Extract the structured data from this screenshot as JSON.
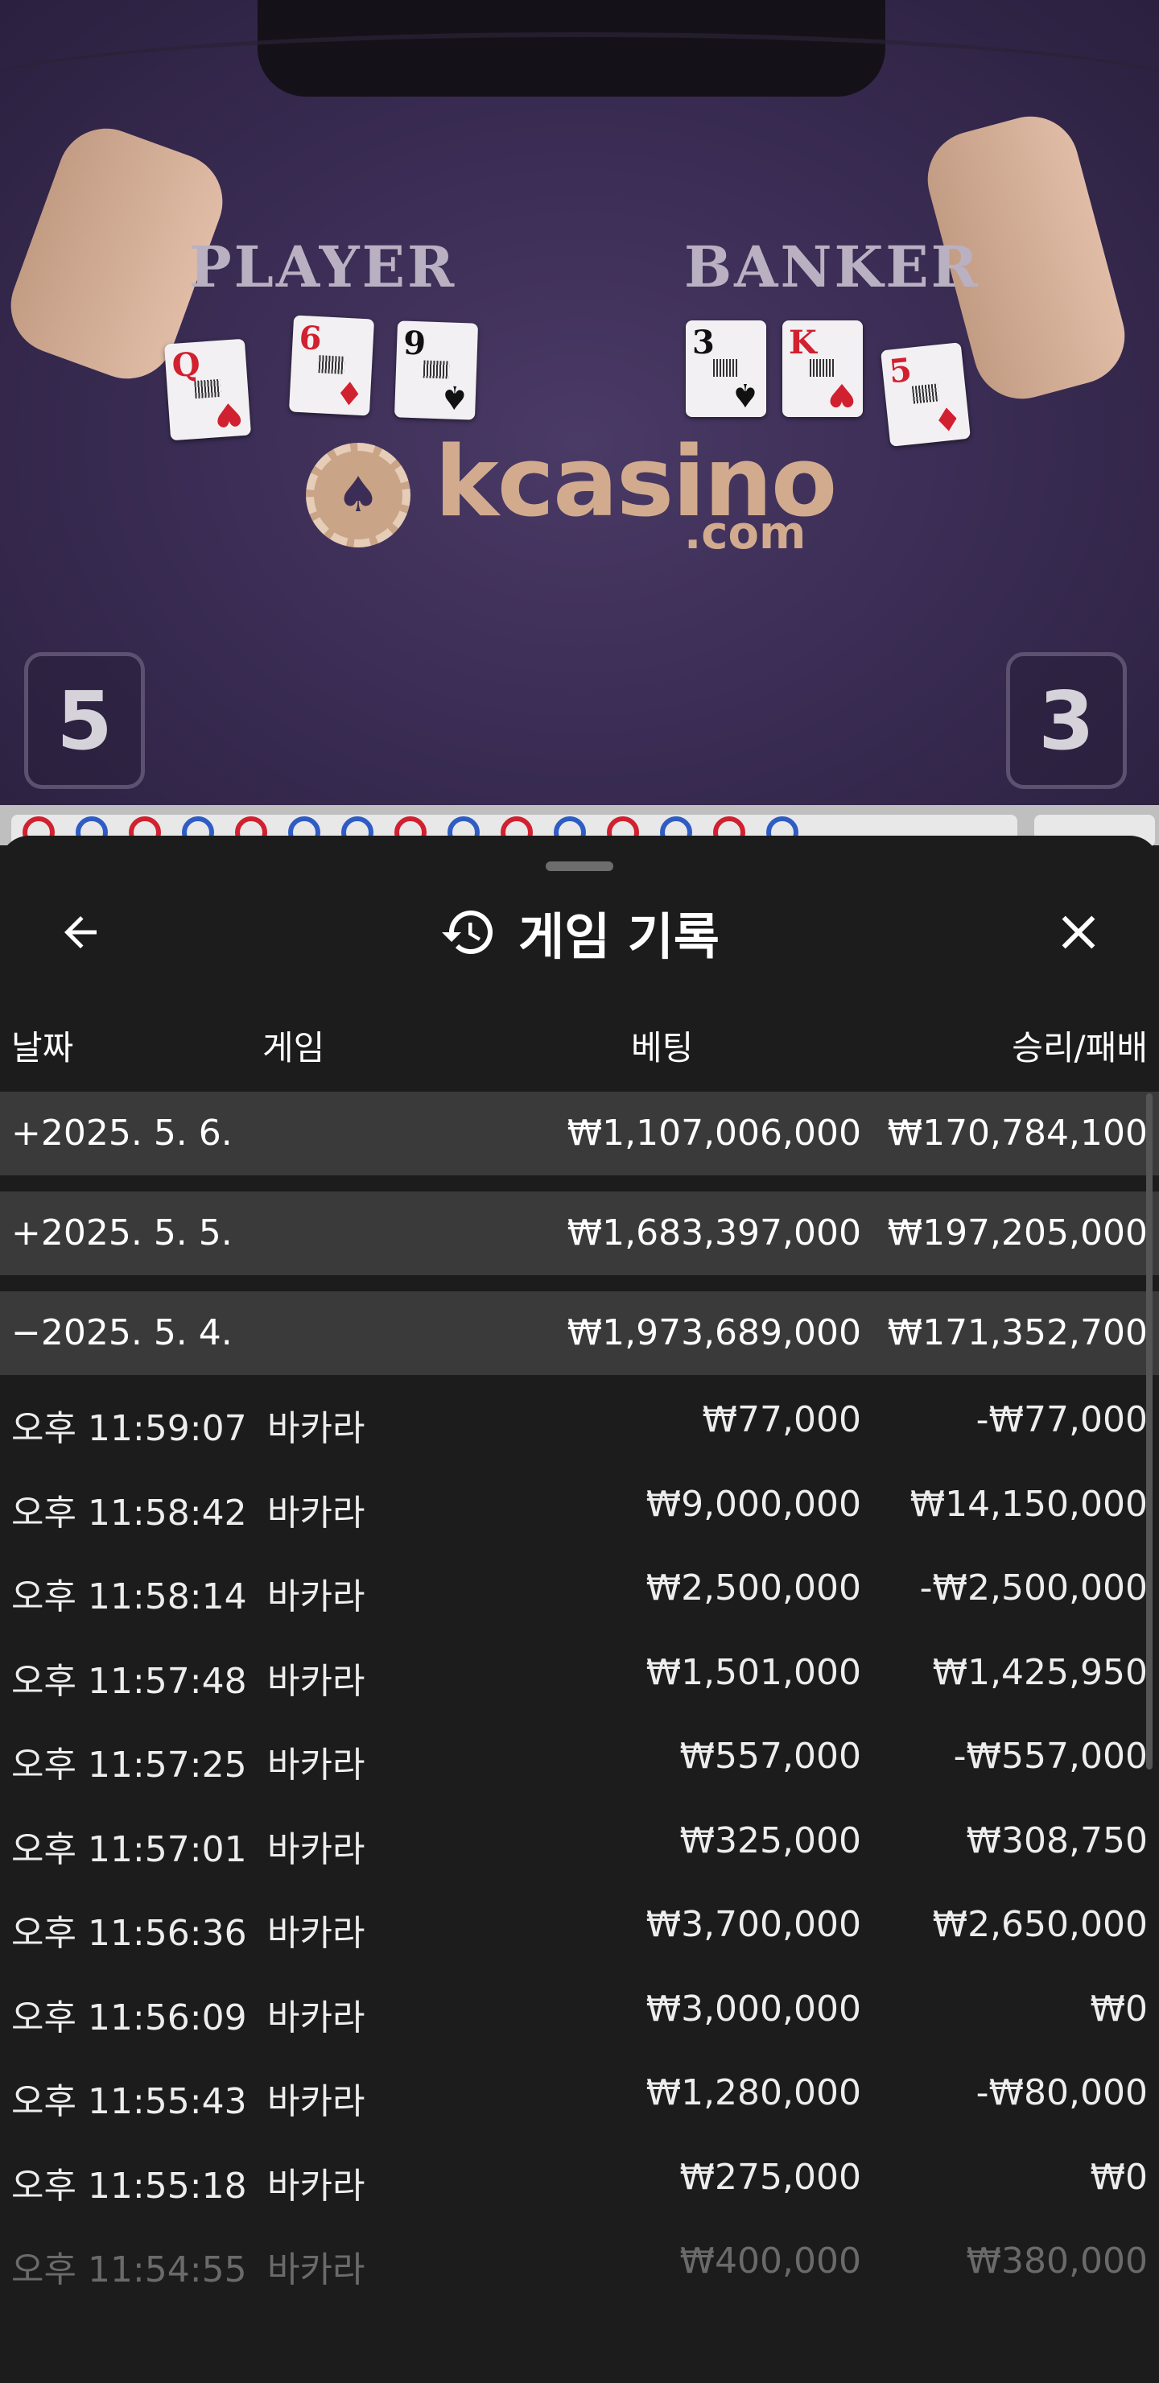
{
  "video": {
    "player_label": "PLAYER",
    "banker_label": "BANKER",
    "player_cards": [
      {
        "rank": "Q",
        "suit": "♥",
        "color": "red"
      },
      {
        "rank": "6",
        "suit": "♦",
        "color": "red"
      },
      {
        "rank": "9",
        "suit": "♠",
        "color": "blk"
      }
    ],
    "banker_cards": [
      {
        "rank": "3",
        "suit": "♠",
        "color": "blk"
      },
      {
        "rank": "K",
        "suit": "♥",
        "color": "red"
      },
      {
        "rank": "5",
        "suit": "♦",
        "color": "red"
      }
    ],
    "logo_word": "kcasino",
    "logo_domain": ".com",
    "player_score": "5",
    "banker_score": "3"
  },
  "sheet": {
    "title": "게임 기록",
    "columns": {
      "date": "날짜",
      "game": "게임",
      "bet": "베팅",
      "result": "승리/패배"
    }
  },
  "days": [
    {
      "date": "+2025. 5. 6.",
      "bet": "₩1,107,006,000",
      "result": "₩170,784,100"
    },
    {
      "date": "+2025. 5. 5.",
      "bet": "₩1,683,397,000",
      "result": "₩197,205,000"
    },
    {
      "date": "−2025. 5. 4.",
      "bet": "₩1,973,689,000",
      "result": "₩171,352,700"
    }
  ],
  "records": [
    {
      "time": "오후 11:59:07",
      "game": "바카라",
      "bet": "₩77,000",
      "result": "-₩77,000"
    },
    {
      "time": "오후 11:58:42",
      "game": "바카라",
      "bet": "₩9,000,000",
      "result": "₩14,150,000"
    },
    {
      "time": "오후 11:58:14",
      "game": "바카라",
      "bet": "₩2,500,000",
      "result": "-₩2,500,000"
    },
    {
      "time": "오후 11:57:48",
      "game": "바카라",
      "bet": "₩1,501,000",
      "result": "₩1,425,950"
    },
    {
      "time": "오후 11:57:25",
      "game": "바카라",
      "bet": "₩557,000",
      "result": "-₩557,000"
    },
    {
      "time": "오후 11:57:01",
      "game": "바카라",
      "bet": "₩325,000",
      "result": "₩308,750"
    },
    {
      "time": "오후 11:56:36",
      "game": "바카라",
      "bet": "₩3,700,000",
      "result": "₩2,650,000"
    },
    {
      "time": "오후 11:56:09",
      "game": "바카라",
      "bet": "₩3,000,000",
      "result": "₩0"
    },
    {
      "time": "오후 11:55:43",
      "game": "바카라",
      "bet": "₩1,280,000",
      "result": "-₩80,000"
    },
    {
      "time": "오후 11:55:18",
      "game": "바카라",
      "bet": "₩275,000",
      "result": "₩0"
    },
    {
      "time": "오후 11:54:55",
      "game": "바카라",
      "bet": "₩400,000",
      "result": "₩380,000"
    }
  ],
  "icons": {
    "back": "arrow-left-icon",
    "history": "history-icon",
    "close": "close-icon"
  },
  "colors": {
    "sheet_bg": "#1c1c1c",
    "day_row_bg": "#3a3a3a",
    "table_felt": "#3b2d55",
    "accent_logo": "#d2ab8f"
  }
}
